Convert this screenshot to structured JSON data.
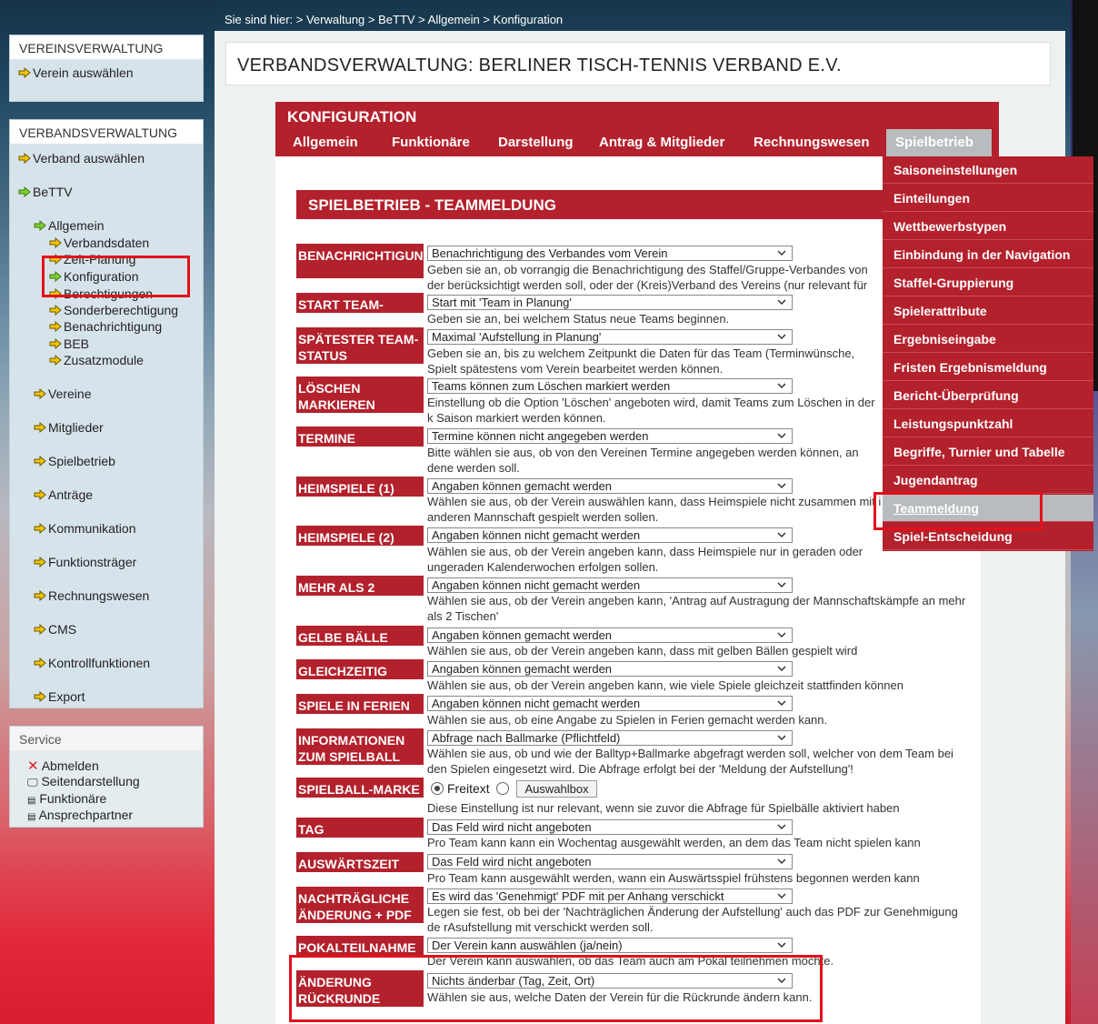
{
  "breadcrumb": "Sie sind hier: > Verwaltung > BeTTV > Allgemein > Konfiguration",
  "page_title": "VERBANDSVERWALTUNG: BERLINER TISCH-TENNIS VERBAND E.V.",
  "sidebar": {
    "vereinsverwaltung": {
      "head": "VEREINSVERWALTUNG",
      "items": [
        "Verein auswählen"
      ]
    },
    "verbandsverwaltung": {
      "head": "VERBANDSVERWALTUNG",
      "items": [
        "Verband auswählen",
        "BeTTV",
        "Allgemein",
        "Verbandsdaten",
        "Zeit-Planung",
        "Konfiguration",
        "Berechtigungen",
        "Sonderberechtigung",
        "Benachrichtigung",
        "BEB",
        "Zusatzmodule",
        "Vereine",
        "Mitglieder",
        "Spielbetrieb",
        "Anträge",
        "Kommunikation",
        "Funktionsträger",
        "Rechnungswesen",
        "CMS",
        "Kontrollfunktionen",
        "Export"
      ]
    },
    "service": {
      "head": "Service",
      "items": [
        "Abmelden",
        "Seitendarstellung",
        "Funktionäre",
        "Ansprechpartner"
      ]
    }
  },
  "konfig": {
    "title": "KONFIGURATION",
    "tabs": [
      "Allgemein",
      "Funktionäre",
      "Darstellung",
      "Antrag & Mitglieder",
      "Rechnungswesen",
      "Spielbetrieb"
    ]
  },
  "section_title": "SPIELBETRIEB - TEAMMELDUNG",
  "dropdown": [
    "Saisoneinstellungen",
    "Einteilungen",
    "Wettbewerbstypen",
    "Einbindung in der Navigation",
    "Staffel-Gruppierung",
    "Spielerattribute",
    "Ergebniseingabe",
    "Fristen Ergebnismeldung",
    "Bericht-Überprüfung",
    "Leistungspunktzahl",
    "Begriffe, Turnier und Tabelle",
    "Jugendantrag",
    "Teammeldung",
    "Spiel-Entscheidung"
  ],
  "fields": [
    {
      "label": "BENACHRICHTIGUNG",
      "value": "Benachrichtigung des Verbandes vom Verein",
      "desc": "Geben sie an, ob vorrangig die Benachrichtigung des Staffel/Gruppe-Verbandes von der berücksichtigt werden soll, oder der (Kreis)Verband des Vereins (nur relevant für größer"
    },
    {
      "label": "START TEAM-STATUS",
      "value": "Start mit 'Team in Planung'",
      "desc": "Geben sie an, bei welchem Status neue Teams beginnen."
    },
    {
      "label": "SPÄTESTER TEAM-STATUS",
      "value": "Maximal 'Aufstellung in Planung'",
      "desc": "Geben sie an, bis zu welchem Zeitpunkt die Daten für das Team (Terminwünsche, Spielt spätestens vom Verein bearbeitet werden können."
    },
    {
      "label": "LÖSCHEN MARKIEREN",
      "value": "Teams können zum Löschen markiert werden",
      "desc": "Einstellung ob die Option 'Löschen' angeboten wird, damit Teams zum Löschen in der k Saison markiert werden können."
    },
    {
      "label": "TERMINE",
      "value": "Termine können nicht angegeben werden",
      "desc": "Bitte wählen sie aus, ob von den Vereinen Termine angegeben werden können, an dene werden soll."
    },
    {
      "label": "HEIMSPIELE (1)",
      "value": "Angaben können gemacht werden",
      "desc": "Wählen sie aus, ob der Verein auswählen kann, dass Heimspiele nicht zusammen mit i anderen Mannschaft gespielt werden sollen."
    },
    {
      "label": "HEIMSPIELE (2)",
      "value": "Angaben können nicht gemacht werden",
      "desc": "Wählen sie aus, ob der Verein angeben kann, dass Heimspiele nur in geraden oder ungeraden Kalenderwochen erfolgen sollen."
    },
    {
      "label": "MEHR ALS 2 TISCHEN",
      "value": "Angaben können nicht gemacht werden",
      "desc": "Wählen sie aus, ob der Verein angeben kann, 'Antrag auf Austragung der Mannschaftskämpfe an mehr als 2 Tischen'"
    },
    {
      "label": "GELBE BÄLLE",
      "value": "Angaben können gemacht werden",
      "desc": "Wählen sie aus, ob der Verein angeben kann, dass mit gelben Bällen gespielt wird"
    },
    {
      "label": "GLEICHZEITIG",
      "value": "Angaben können gemacht werden",
      "desc": "Wählen sie aus, ob der Verein angeben kann, wie viele Spiele gleichzeit stattfinden können"
    },
    {
      "label": "SPIELE IN FERIEN",
      "value": "Angaben können nicht gemacht werden",
      "desc": "Wählen sie aus, ob eine Angabe zu Spielen in Ferien gemacht werden kann."
    },
    {
      "label": "INFORMATIONEN ZUM SPIELBALL",
      "value": "Abfrage nach Ballmarke (Pflichtfeld)",
      "desc": "Wählen sie aus, ob und wie der Balltyp+Ballmarke abgefragt werden soll, welcher von dem Team bei den Spielen eingesetzt wird. Die Abfrage erfolgt bei der 'Meldung der Aufstellung'!"
    },
    {
      "label": "SPIELBALL-MARKE",
      "radio1": "Freitext",
      "radio2": "Auswahlbox",
      "desc": "Diese Einstellung ist nur relevant, wenn sie zuvor die Abfrage für Spielbälle aktiviert haben"
    },
    {
      "label": "TAG AUSSCHLIESSEN",
      "value": "Das Feld wird nicht angeboten",
      "desc": "Pro Team kann kann ein Wochentag ausgewählt werden, an dem das Team nicht spielen kann"
    },
    {
      "label": "AUSWÄRTSZEIT",
      "value": "Das Feld wird nicht angeboten",
      "desc": "Pro Team kann ausgewählt werden, wann ein Auswärtsspiel frühstens begonnen werden kann"
    },
    {
      "label": "NACHTRÄGLICHE ÄNDERUNG + PDF",
      "value": "Es wird das 'Genehmigt' PDF mit per Anhang verschickt",
      "desc": "Legen sie fest, ob bei der 'Nachträglichen Änderung der Aufstellung' auch das PDF zur Genehmigung de rAsufstellung mit verschickt werden soll."
    },
    {
      "label": "POKALTEILNAHME",
      "value": "Der Verein kann auswählen (ja/nein)",
      "desc": "Der Verein kann auswählen, ob das Team auch am Pokal teilnehmen möchte."
    },
    {
      "label": "ÄNDERUNG RÜCKRUNDE",
      "value": "Nichts änderbar (Tag, Zeit, Ort)",
      "desc": "Wählen sie aus, welche Daten der Verein für die Rückrunde ändern kann."
    }
  ],
  "colors": {
    "brand_red": "#b3212c",
    "highlight": "#e3101b",
    "active_tab": "#b9bcbe"
  }
}
